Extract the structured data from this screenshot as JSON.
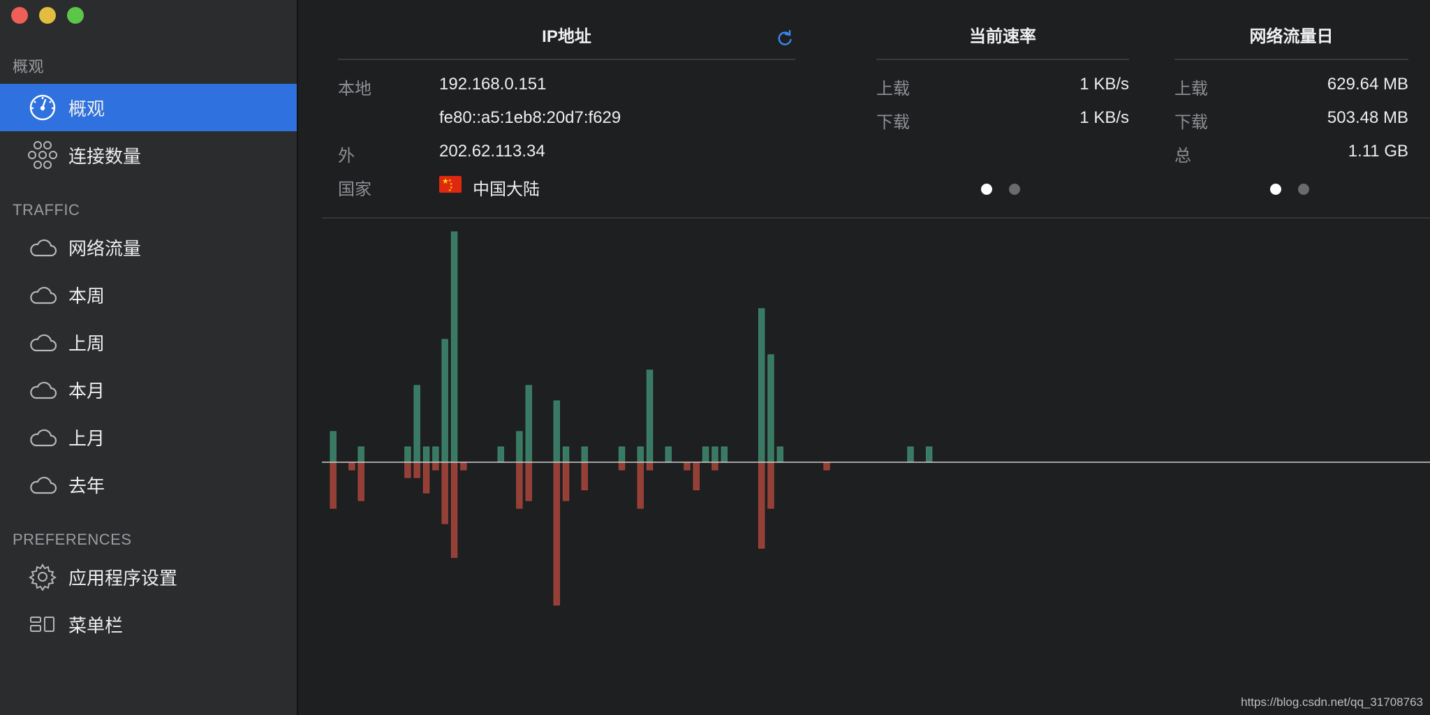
{
  "window": {
    "title": ""
  },
  "sidebar": {
    "sections": [
      {
        "title": "概观"
      },
      {
        "title": "TRAFFIC"
      },
      {
        "title": "PREFERENCES"
      }
    ],
    "items": [
      {
        "label": "概观",
        "icon": "gauge-icon",
        "active": true
      },
      {
        "label": "连接数量",
        "icon": "connections-icon",
        "active": false
      },
      {
        "label": "网络流量",
        "icon": "cloud-icon",
        "active": false
      },
      {
        "label": "本周",
        "icon": "cloud-icon",
        "active": false
      },
      {
        "label": "上周",
        "icon": "cloud-icon",
        "active": false
      },
      {
        "label": "本月",
        "icon": "cloud-icon",
        "active": false
      },
      {
        "label": "上月",
        "icon": "cloud-icon",
        "active": false
      },
      {
        "label": "去年",
        "icon": "cloud-icon",
        "active": false
      },
      {
        "label": "应用程序设置",
        "icon": "gear-icon",
        "active": false
      },
      {
        "label": "菜单栏",
        "icon": "menubar-icon",
        "active": false
      }
    ]
  },
  "ip": {
    "title": "IP地址",
    "rows": [
      {
        "label": "本地",
        "value": "192.168.0.151"
      },
      {
        "label": "",
        "value": "fe80::a5:1eb8:20d7:f629"
      },
      {
        "label": "外",
        "value": "202.62.113.34"
      },
      {
        "label": "国家",
        "value": "中国大陆"
      }
    ]
  },
  "speed": {
    "title": "当前速率",
    "rows": [
      {
        "label": "上载",
        "value": "1 KB/s"
      },
      {
        "label": "下载",
        "value": "1 KB/s"
      }
    ]
  },
  "daily": {
    "title": "网络流量日",
    "rows": [
      {
        "label": "上载",
        "value": "629.64 MB"
      },
      {
        "label": "下载",
        "value": "503.48 MB"
      },
      {
        "label": "总",
        "value": "1.11 GB"
      }
    ]
  },
  "colors": {
    "accent": "#2f71de",
    "upload": "#3f8a6e",
    "download": "#a9463b"
  },
  "chart_data": {
    "type": "bar",
    "x": [
      1,
      2,
      3,
      4,
      5,
      6,
      7,
      8,
      9,
      10,
      11,
      12,
      13,
      14,
      15,
      16,
      17,
      18,
      19,
      20,
      21,
      22,
      23,
      24,
      25,
      26,
      27,
      28,
      29,
      30,
      31,
      32,
      33,
      34,
      35,
      36,
      37,
      38,
      39,
      40,
      41,
      42,
      43,
      44,
      45,
      46,
      47,
      48,
      49,
      50,
      51,
      52,
      53,
      54,
      55,
      56,
      57,
      58,
      59,
      60,
      61,
      62,
      63,
      64,
      65,
      66,
      67,
      68,
      69,
      70,
      71,
      72,
      73,
      74,
      75,
      76,
      77,
      78,
      79,
      80,
      81,
      82,
      83,
      84,
      85,
      86,
      87,
      88,
      89,
      90,
      91,
      92,
      93,
      94,
      95,
      96,
      97,
      98,
      99,
      100,
      101,
      102,
      103,
      104,
      105,
      106,
      107,
      108,
      109,
      110,
      111,
      112,
      113,
      114,
      115,
      116,
      117,
      118,
      119
    ],
    "series": [
      {
        "values": [
          20,
          0,
          0,
          10,
          0,
          0,
          0,
          0,
          10,
          50,
          10,
          10,
          80,
          150,
          0,
          0,
          0,
          0,
          10,
          0,
          20,
          50,
          0,
          0,
          40,
          10,
          0,
          10,
          0,
          0,
          0,
          10,
          0,
          10,
          60,
          0,
          10,
          0,
          0,
          0,
          10,
          10,
          10,
          0,
          0,
          0,
          100,
          70,
          10,
          0,
          0,
          0,
          0,
          0,
          0,
          0,
          0,
          0,
          0,
          0,
          0,
          0,
          10,
          0,
          10,
          0,
          0,
          0,
          0,
          0,
          0,
          0,
          0,
          0,
          0,
          0,
          0,
          0,
          0,
          0,
          0,
          0,
          0,
          0,
          0,
          0,
          0,
          0,
          0,
          0,
          0,
          0,
          0,
          0,
          0,
          0,
          0,
          0,
          0,
          0,
          0,
          0,
          0,
          0,
          0,
          0,
          0,
          0,
          0,
          0,
          0,
          0,
          0,
          0,
          0,
          0,
          0,
          0,
          0
        ]
      },
      {
        "values": [
          -30,
          0,
          -5,
          -25,
          0,
          0,
          0,
          0,
          -10,
          -10,
          -20,
          -5,
          -40,
          -62,
          -5,
          0,
          0,
          0,
          0,
          0,
          -30,
          -25,
          0,
          0,
          -93,
          -25,
          0,
          -18,
          0,
          0,
          0,
          -5,
          0,
          -30,
          -5,
          0,
          0,
          0,
          -5,
          -18,
          0,
          -5,
          0,
          0,
          0,
          0,
          -56,
          -30,
          0,
          0,
          0,
          0,
          0,
          -5,
          0,
          0,
          0,
          0,
          0,
          0,
          0,
          0,
          0,
          0,
          0,
          0,
          0,
          0,
          0,
          0,
          0,
          0,
          0,
          0,
          0,
          0,
          0,
          0,
          0,
          0,
          0,
          0,
          0,
          0,
          0,
          0,
          0,
          0,
          0,
          0,
          0,
          0,
          0,
          0,
          0,
          0,
          0,
          0,
          0,
          0,
          0,
          0,
          0,
          0,
          0,
          0,
          0,
          0,
          0,
          0,
          0,
          0,
          0,
          0,
          0,
          0,
          0,
          0,
          0
        ]
      }
    ]
  },
  "watermark": "https://blog.csdn.net/qq_31708763"
}
